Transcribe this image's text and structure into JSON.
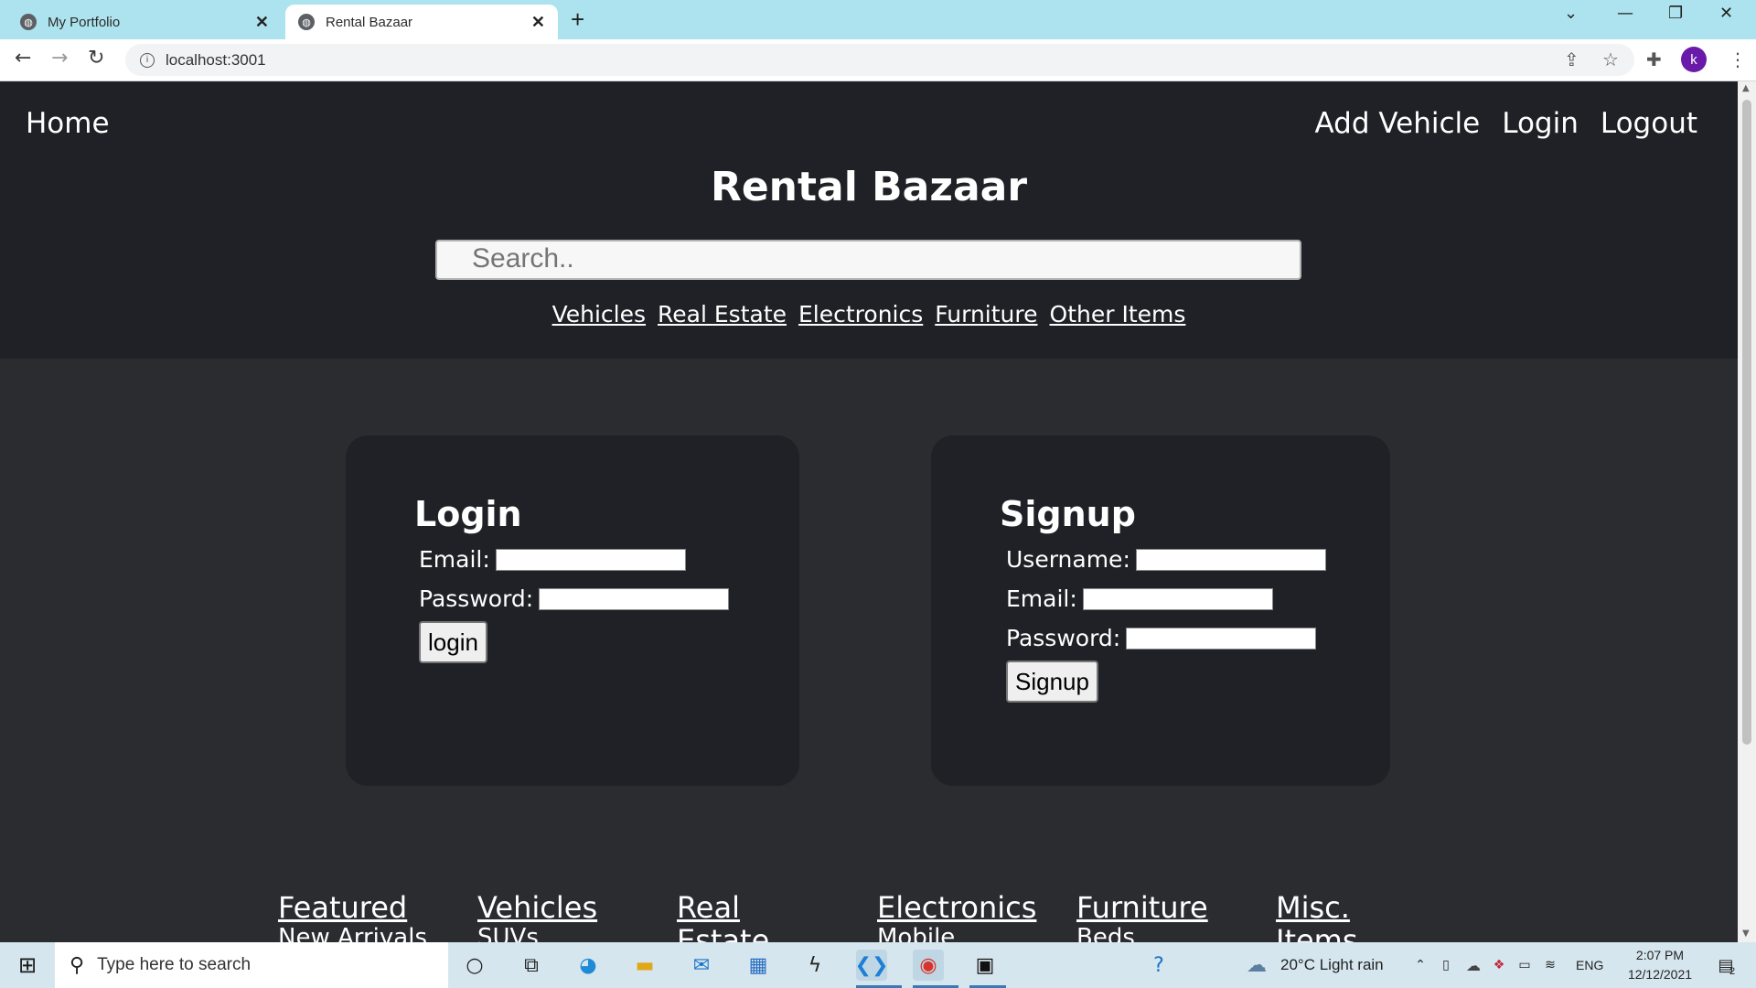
{
  "browser": {
    "tabs": [
      {
        "title": "My Portfolio",
        "active": false
      },
      {
        "title": "Rental Bazaar",
        "active": true
      }
    ],
    "url": "localhost:3001",
    "profile_initial": "k"
  },
  "nav": {
    "home": "Home",
    "right": [
      "Add Vehicle",
      "Login",
      "Logout"
    ]
  },
  "site_title": "Rental Bazaar",
  "search": {
    "placeholder": "Search.."
  },
  "categories": [
    "Vehicles",
    "Real Estate",
    "Electronics",
    "Furniture",
    "Other Items"
  ],
  "login": {
    "title": "Login",
    "email_label": "Email:",
    "password_label": "Password:",
    "button": "login"
  },
  "signup": {
    "title": "Signup",
    "username_label": "Username:",
    "email_label": "Email:",
    "password_label": "Password:",
    "button": "Signup"
  },
  "footer": [
    {
      "heading": "Featured",
      "sub": "New Arrivals"
    },
    {
      "heading": "Vehicles",
      "sub": "SUVs"
    },
    {
      "heading": "Real Estate",
      "sub": ""
    },
    {
      "heading": "Electronics",
      "sub": "Mobile"
    },
    {
      "heading": "Furniture",
      "sub": "Beds"
    },
    {
      "heading": "Misc. Items",
      "sub": ""
    }
  ],
  "taskbar": {
    "search_placeholder": "Type here to search",
    "weather": "20°C  Light rain",
    "language": "ENG",
    "time": "2:07 PM",
    "date": "12/12/2021",
    "notifications": "2"
  }
}
